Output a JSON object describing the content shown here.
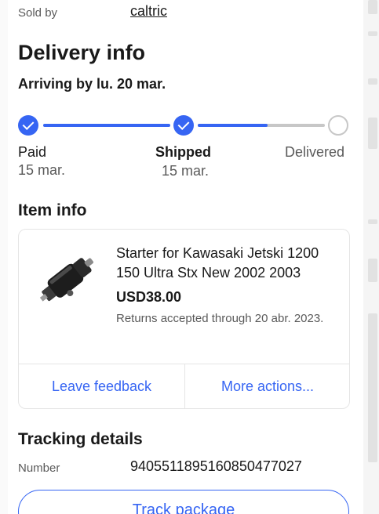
{
  "seller": {
    "label": "Sold by",
    "name": "caltric"
  },
  "delivery": {
    "heading": "Delivery info",
    "arriving": "Arriving by lu. 20 mar.",
    "stages": [
      {
        "label": "Paid",
        "date": "15 mar.",
        "state": "done"
      },
      {
        "label": "Shipped",
        "date": "15 mar.",
        "state": "done"
      },
      {
        "label": "Delivered",
        "date": "",
        "state": "pending"
      }
    ],
    "progress_second_segment": 0.55,
    "accent_color": "#3665f3"
  },
  "item": {
    "heading": "Item info",
    "title": "Starter for Kawasaki Jetski 1200 150 Ultra Stx New 2002 2003",
    "price": "USD38.00",
    "returns": "Returns accepted through 20 abr. 2023.",
    "thumbnail_icon": "starter-motor-image",
    "actions": {
      "feedback": "Leave feedback",
      "more": "More actions..."
    }
  },
  "tracking": {
    "heading": "Tracking details",
    "number_label": "Number",
    "number": "9405511895160850477027",
    "button": "Track package"
  }
}
